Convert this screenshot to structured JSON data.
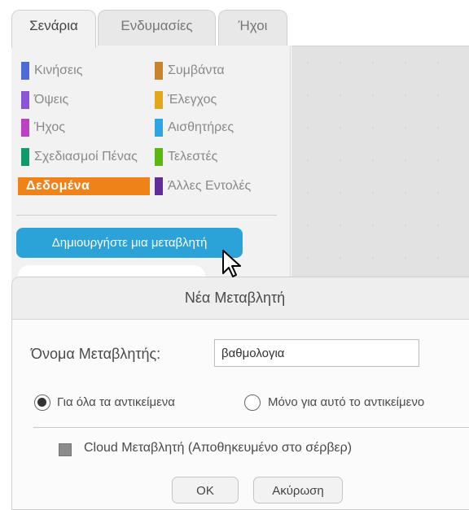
{
  "tabs": [
    {
      "label": "Σενάρια",
      "active": true
    },
    {
      "label": "Ενδυμασίες",
      "active": false
    },
    {
      "label": "Ήχοι",
      "active": false
    }
  ],
  "categories": [
    {
      "label": "Κινήσεις",
      "color": "#4a6cd4"
    },
    {
      "label": "Όψεις",
      "color": "#8a55d7"
    },
    {
      "label": "Ήχος",
      "color": "#bb42c3"
    },
    {
      "label": "Σχεδιασμοί Πένας",
      "color": "#0e9a6c"
    },
    {
      "label": "Δεδομένα",
      "color": "#f0821a",
      "selected": true
    },
    {
      "label": "Συμβάντα",
      "color": "#c88330"
    },
    {
      "label": "Έλεγχος",
      "color": "#e1a91a"
    },
    {
      "label": "Αισθητήρες",
      "color": "#2ca5e2"
    },
    {
      "label": "Τελεστές",
      "color": "#5cb712"
    },
    {
      "label": "Άλλες Εντολές",
      "color": "#632d99"
    }
  ],
  "make_variable_button": "Δημιουργήστε μια μεταβλητή",
  "dialog": {
    "title": "Νέα Μεταβλητή",
    "name_label": "Όνομα Μεταβλητής:",
    "name_value": "βαθμολογια",
    "radio_all": "Για όλα τα αντικείμενα",
    "radio_this": "Μόνο για αυτό το αντικείμενο",
    "radio_selected": "all",
    "cloud_label": "Cloud Μεταβλητή (Αποθηκευμένο στο σέρβερ)",
    "cloud_checked": false,
    "ok_label": "OK",
    "cancel_label": "Ακύρωση"
  }
}
